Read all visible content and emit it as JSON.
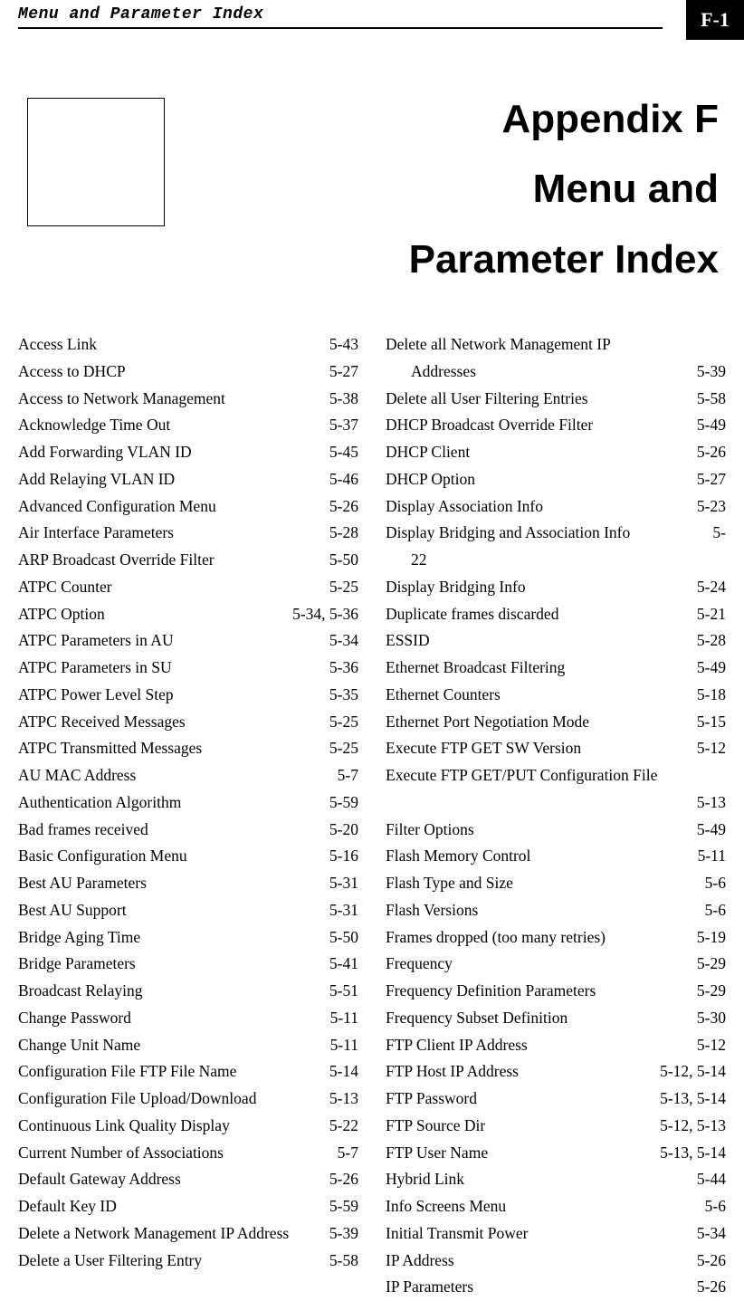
{
  "header": {
    "running_title": "Menu and Parameter Index",
    "page_badge": "F-1"
  },
  "title": {
    "line1": "Appendix F",
    "line2": "Menu and",
    "line3": "Parameter Index"
  },
  "index": {
    "left": [
      {
        "label": "Access Link",
        "page": "5-43"
      },
      {
        "label": "Access to DHCP",
        "page": "5-27"
      },
      {
        "label": "Access to Network Management",
        "page": "5-38"
      },
      {
        "label": "Acknowledge Time Out",
        "page": "5-37"
      },
      {
        "label": "Add Forwarding VLAN ID",
        "page": "5-45"
      },
      {
        "label": "Add Relaying VLAN ID",
        "page": "5-46"
      },
      {
        "label": "Advanced Configuration Menu",
        "page": "5-26"
      },
      {
        "label": "Air Interface Parameters",
        "page": "5-28"
      },
      {
        "label": "ARP Broadcast Override Filter",
        "page": "5-50"
      },
      {
        "label": "ATPC Counter",
        "page": "5-25"
      },
      {
        "label": "ATPC Option",
        "page": "5-34, 5-36"
      },
      {
        "label": "ATPC Parameters in AU",
        "page": "5-34"
      },
      {
        "label": "ATPC Parameters in SU",
        "page": "5-36"
      },
      {
        "label": "ATPC Power Level Step",
        "page": "5-35"
      },
      {
        "label": "ATPC Received Messages",
        "page": "5-25"
      },
      {
        "label": "ATPC Transmitted Messages",
        "page": "5-25"
      },
      {
        "label": "AU MAC Address",
        "page": "5-7"
      },
      {
        "label": "Authentication Algorithm",
        "page": "5-59"
      },
      {
        "label": "Bad frames received",
        "page": "5-20"
      },
      {
        "label": "Basic Configuration Menu",
        "page": "5-16"
      },
      {
        "label": "Best AU Parameters",
        "page": "5-31"
      },
      {
        "label": "Best AU Support",
        "page": "5-31"
      },
      {
        "label": "Bridge Aging Time",
        "page": "5-50"
      },
      {
        "label": "Bridge Parameters",
        "page": "5-41"
      },
      {
        "label": "Broadcast Relaying",
        "page": "5-51"
      },
      {
        "label": "Change Password",
        "page": "5-11"
      },
      {
        "label": "Change Unit Name",
        "page": "5-11"
      },
      {
        "label": "Configuration File FTP File Name",
        "page": "5-14"
      },
      {
        "label": "Configuration File Upload/Download",
        "page": "5-13"
      },
      {
        "label": "Continuous Link Quality Display",
        "page": "5-22"
      },
      {
        "label": "Current Number of Associations",
        "page": "5-7"
      },
      {
        "label": "Default Gateway Address",
        "page": "5-26"
      },
      {
        "label": "Default Key ID",
        "page": "5-59"
      },
      {
        "label": "Delete a Network Management IP Address",
        "page": "5-39"
      },
      {
        "label": "Delete a User Filtering Entry",
        "page": "5-58"
      }
    ],
    "right": [
      {
        "label": "Delete all Network Management IP",
        "page": ""
      },
      {
        "label": "Addresses",
        "page": "5-39",
        "indent": true
      },
      {
        "label": "Delete all User Filtering Entries",
        "page": "5-58"
      },
      {
        "label": "DHCP Broadcast Override Filter",
        "page": "5-49"
      },
      {
        "label": "DHCP Client",
        "page": "5-26"
      },
      {
        "label": "DHCP Option",
        "page": "5-27"
      },
      {
        "label": "Display Association Info",
        "page": "5-23"
      },
      {
        "label": "Display Bridging and Association Info",
        "page": "5-"
      },
      {
        "label": "22",
        "page": "",
        "indent": true
      },
      {
        "label": "Display Bridging Info",
        "page": "5-24"
      },
      {
        "label": "Duplicate frames discarded",
        "page": "5-21"
      },
      {
        "label": "ESSID",
        "page": "5-28"
      },
      {
        "label": "Ethernet Broadcast Filtering",
        "page": "5-49"
      },
      {
        "label": "Ethernet Counters",
        "page": "5-18"
      },
      {
        "label": "Ethernet Port Negotiation Mode",
        "page": "5-15"
      },
      {
        "label": "Execute FTP GET SW Version",
        "page": "5-12"
      },
      {
        "label": "Execute FTP GET/PUT Configuration File",
        "page": ""
      },
      {
        "label": "",
        "page": "5-13",
        "nolabel": true
      },
      {
        "label": "Filter Options",
        "page": "5-49"
      },
      {
        "label": "Flash Memory Control",
        "page": "5-11"
      },
      {
        "label": "Flash Type and Size",
        "page": "5-6"
      },
      {
        "label": "Flash Versions",
        "page": "5-6"
      },
      {
        "label": "Frames dropped (too many retries)",
        "page": "5-19"
      },
      {
        "label": "Frequency",
        "page": "5-29"
      },
      {
        "label": "Frequency Definition Parameters",
        "page": "5-29"
      },
      {
        "label": "Frequency Subset Definition",
        "page": "5-30"
      },
      {
        "label": "FTP Client IP Address",
        "page": "5-12"
      },
      {
        "label": "FTP Host IP Address",
        "page": "5-12, 5-14"
      },
      {
        "label": "FTP Password",
        "page": "5-13, 5-14"
      },
      {
        "label": "FTP Source Dir",
        "page": "5-12, 5-13"
      },
      {
        "label": "FTP User Name",
        "page": "5-13, 5-14"
      },
      {
        "label": "Hybrid Link",
        "page": "5-44"
      },
      {
        "label": "Info Screens Menu",
        "page": "5-6"
      },
      {
        "label": "Initial Transmit Power",
        "page": "5-34"
      },
      {
        "label": "IP Address",
        "page": "5-26"
      },
      {
        "label": "IP Parameters",
        "page": "5-26"
      }
    ]
  }
}
